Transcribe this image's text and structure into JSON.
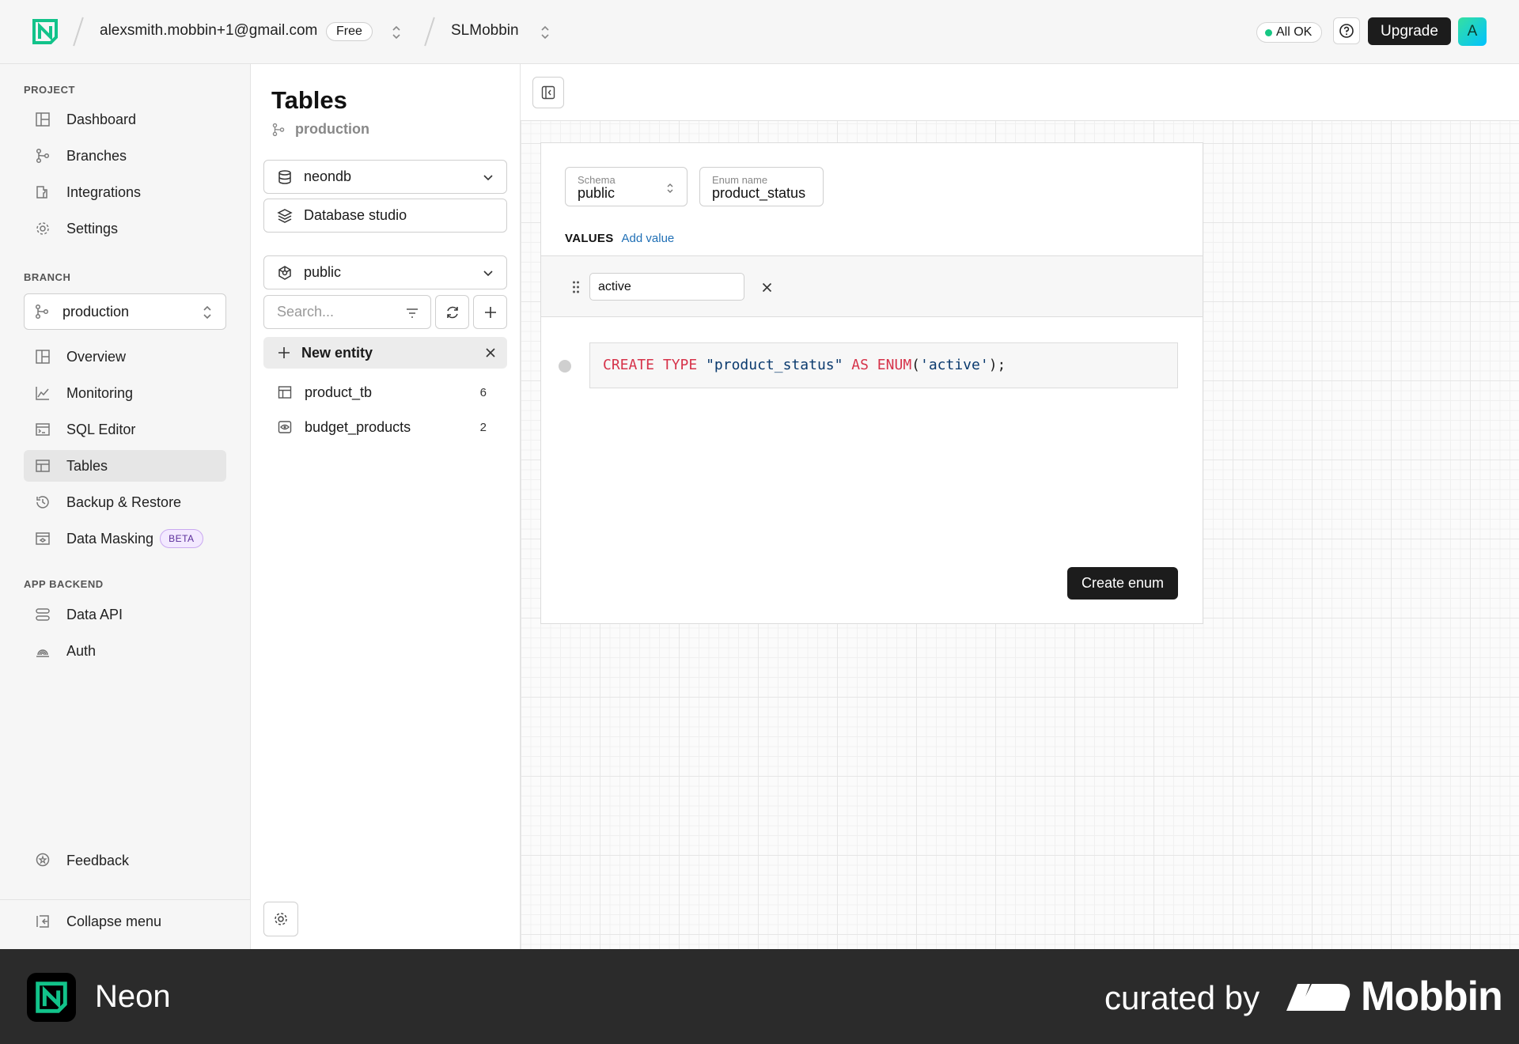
{
  "topbar": {
    "account_email": "alexsmith.mobbin+1@gmail.com",
    "plan_badge": "Free",
    "project_name": "SLMobbin",
    "status": "All OK",
    "upgrade_label": "Upgrade",
    "avatar_initial": "A",
    "status_color": "#16c784"
  },
  "leftnav": {
    "project_label": "PROJECT",
    "project_items": [
      {
        "label": "Dashboard",
        "icon": "dashboard-icon"
      },
      {
        "label": "Branches",
        "icon": "branches-icon"
      },
      {
        "label": "Integrations",
        "icon": "integrations-icon"
      },
      {
        "label": "Settings",
        "icon": "gear-icon"
      }
    ],
    "branch_label": "BRANCH",
    "branch_selected": "production",
    "branch_items": [
      {
        "label": "Overview",
        "icon": "overview-icon"
      },
      {
        "label": "Monitoring",
        "icon": "monitoring-icon"
      },
      {
        "label": "SQL Editor",
        "icon": "sql-editor-icon"
      },
      {
        "label": "Tables",
        "icon": "tables-icon",
        "active": true
      },
      {
        "label": "Backup & Restore",
        "icon": "backup-icon"
      },
      {
        "label": "Data Masking",
        "icon": "data-masking-icon",
        "badge": "BETA"
      }
    ],
    "app_backend_label": "APP BACKEND",
    "app_backend_items": [
      {
        "label": "Data API",
        "icon": "data-api-icon"
      },
      {
        "label": "Auth",
        "icon": "auth-icon"
      }
    ],
    "feedback_label": "Feedback",
    "collapse_label": "Collapse menu"
  },
  "tables_panel": {
    "title": "Tables",
    "branch": "production",
    "database": "neondb",
    "studio_label": "Database studio",
    "schema": "public",
    "search_placeholder": "Search...",
    "new_entity_label": "New entity",
    "entities": [
      {
        "name": "product_tb",
        "count": "6",
        "icon": "table-icon"
      },
      {
        "name": "budget_products",
        "count": "2",
        "icon": "view-icon"
      }
    ]
  },
  "enum_editor": {
    "schema_label": "Schema",
    "schema_value": "public",
    "enum_name_label": "Enum name",
    "enum_name_value": "product_status",
    "values_label": "VALUES",
    "add_value_label": "Add value",
    "values": [
      "active"
    ],
    "sql": {
      "kw1": "CREATE TYPE",
      "name": "\"product_status\"",
      "kw2": "AS ENUM",
      "open": "(",
      "literal": "'active'",
      "close": ");"
    },
    "create_label": "Create enum"
  },
  "footer": {
    "app_name": "Neon",
    "curated_by": "curated by",
    "brand": "Mobbin"
  }
}
